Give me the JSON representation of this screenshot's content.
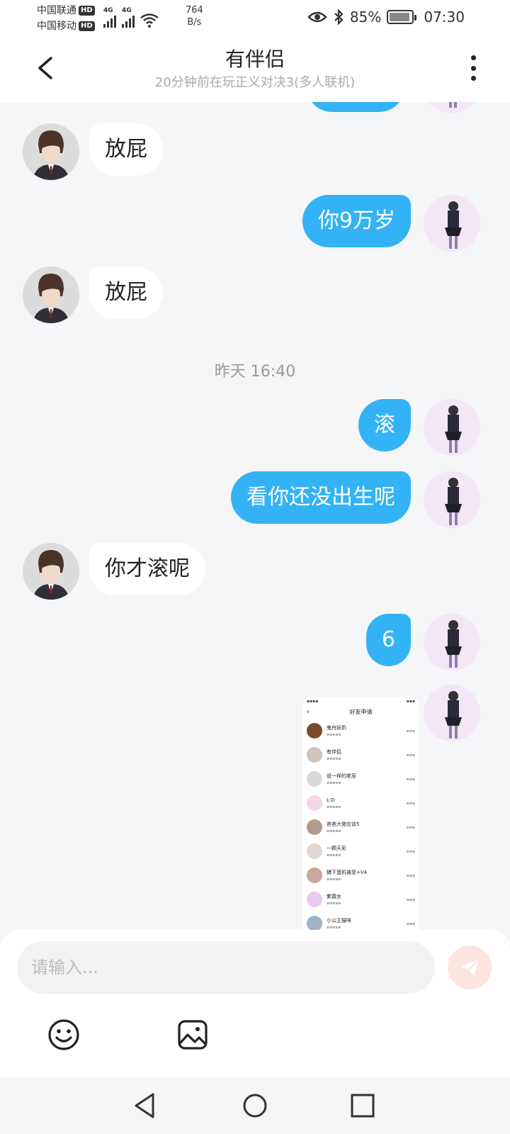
{
  "status_bar": {
    "carrier1": "中国联通",
    "carrier2": "中国移动",
    "hd": "HD",
    "net_type": "4G",
    "net_speed_value": "764",
    "net_speed_unit": "B/s",
    "battery": "85%",
    "time": "07:30"
  },
  "header": {
    "title": "有伴侣",
    "subtitle": "20分钟前在玩正义对决3(多人联机)"
  },
  "messages": [
    {
      "side": "in",
      "text": "放屁"
    },
    {
      "side": "out",
      "text": "你9万岁"
    },
    {
      "side": "in",
      "text": "放屁"
    },
    {
      "side": "out",
      "text": "滚"
    },
    {
      "side": "out",
      "text": "看你还没出生呢"
    },
    {
      "side": "in",
      "text": "你才滚呢"
    },
    {
      "side": "out",
      "text": "6"
    }
  ],
  "timestamp": "昨天 16:40",
  "screenshot": {
    "title": "好友申请",
    "rows": [
      {
        "name": "鬼舟妖奶",
        "color": "#7a4a2a"
      },
      {
        "name": "有伴侣",
        "color": "#cfc3bb"
      },
      {
        "name": "说一样的老巫",
        "color": "#d8d8d8"
      },
      {
        "name": "L-D",
        "color": "#f4d8e8"
      },
      {
        "name": "爸爸大佬应该5",
        "color": "#b39a8a"
      },
      {
        "name": "一颗天彩",
        "color": "#e0d6d2"
      },
      {
        "name": "猪下蛋机被恶+V4",
        "color": "#c9a79a"
      },
      {
        "name": "紫霞女",
        "color": "#e7c9f2"
      },
      {
        "name": "小公主猫咪",
        "color": "#9fb3c8"
      }
    ]
  },
  "input": {
    "placeholder": "请输入..."
  },
  "colors": {
    "bubble_out": "#33b3f5",
    "bubble_in": "#ffffff",
    "send": "#fde4e0"
  }
}
